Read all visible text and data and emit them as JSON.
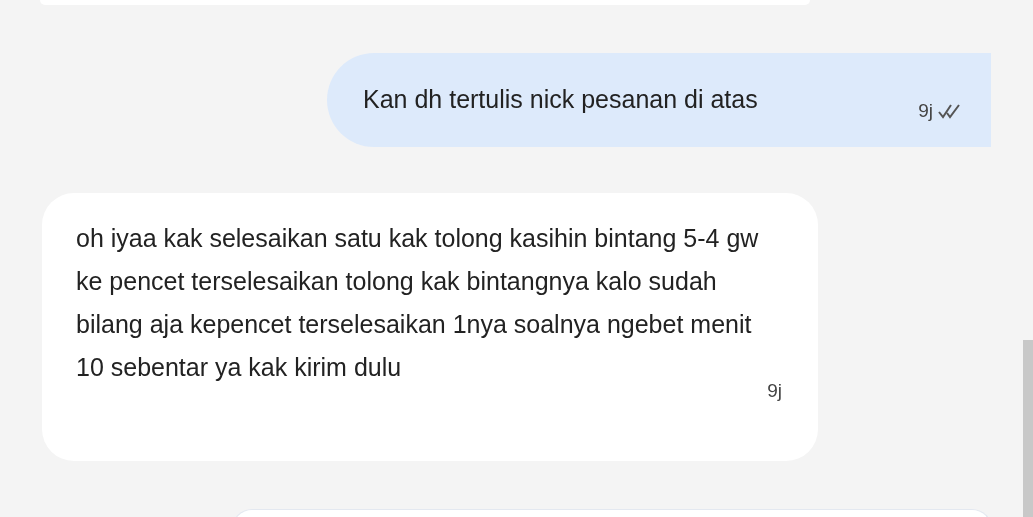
{
  "messages": [
    {
      "kind": "sent",
      "text": "Kan dh tertulis nick pesanan di atas",
      "time": "9j",
      "read": true
    },
    {
      "kind": "received",
      "text": "oh iyaa kak selesaikan satu kak tolong kasihin bintang 5-4 gw ke pencet terselesaikan tolong kak bintangnya kalo sudah bilang aja kepencet terselesaikan 1nya soalnya ngebet menit 10 sebentar ya kak kirim dulu",
      "time": "9j"
    }
  ]
}
